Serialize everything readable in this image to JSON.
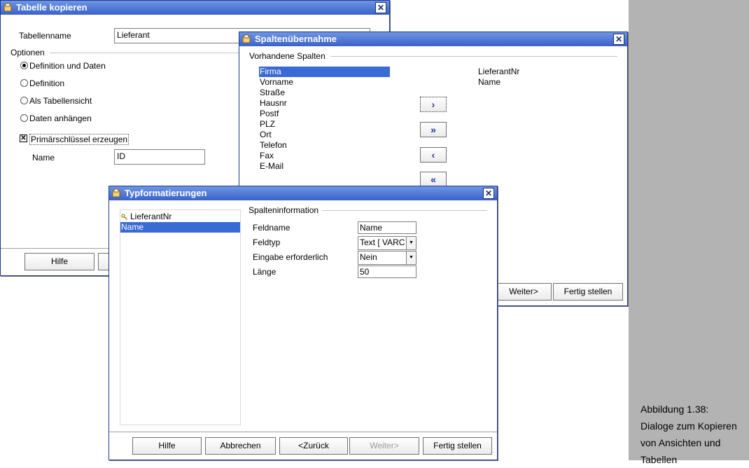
{
  "caption": {
    "line1": "Abbildung 1.38:",
    "line2": "Dialoge zum Kopieren",
    "line3": "von Ansichten und",
    "line4": "Tabellen"
  },
  "copy_dialog": {
    "title": "Tabelle kopieren",
    "table_name_label": "Tabellenname",
    "table_name_value": "Lieferant",
    "options_label": "Optionen",
    "option_def_data": "Definition und Daten",
    "option_def": "Definition",
    "option_view": "Als Tabellensicht",
    "option_append": "Daten anhängen",
    "pk_label": "Primärschlüssel erzeugen",
    "pk_checked": true,
    "name_label": "Name",
    "name_value": "ID",
    "help_button": "Hilfe"
  },
  "columns_dialog": {
    "title": "Spaltenübernahme",
    "existing_label": "Vorhandene Spalten",
    "source_columns": [
      "Firma",
      "Vorname",
      "Straße",
      "Hausnr",
      "Postf",
      "PLZ",
      "Ort",
      "Telefon",
      "Fax",
      "E-Mail"
    ],
    "target_columns": [
      "LieferantNr",
      "Name"
    ],
    "move_one": "›",
    "move_all": "»",
    "back_one": "‹",
    "back_all": "«",
    "next_button": "Weiter>",
    "finish_button": "Fertig stellen"
  },
  "type_dialog": {
    "title": "Typformatierungen",
    "fields": [
      "LieferantNr",
      "Name"
    ],
    "key_icon": "key-icon",
    "section_label": "Spalteninformation",
    "field_name_label": "Feldname",
    "field_name_value": "Name",
    "field_type_label": "Feldtyp",
    "field_type_value": "Text [ VARC",
    "required_label": "Eingabe erforderlich",
    "required_value": "Nein",
    "length_label": "Länge",
    "length_value": "50",
    "help_button": "Hilfe",
    "cancel_button": "Abbrechen",
    "back_button": "<Zurück",
    "next_button": "Weiter>",
    "finish_button": "Fertig stellen"
  }
}
